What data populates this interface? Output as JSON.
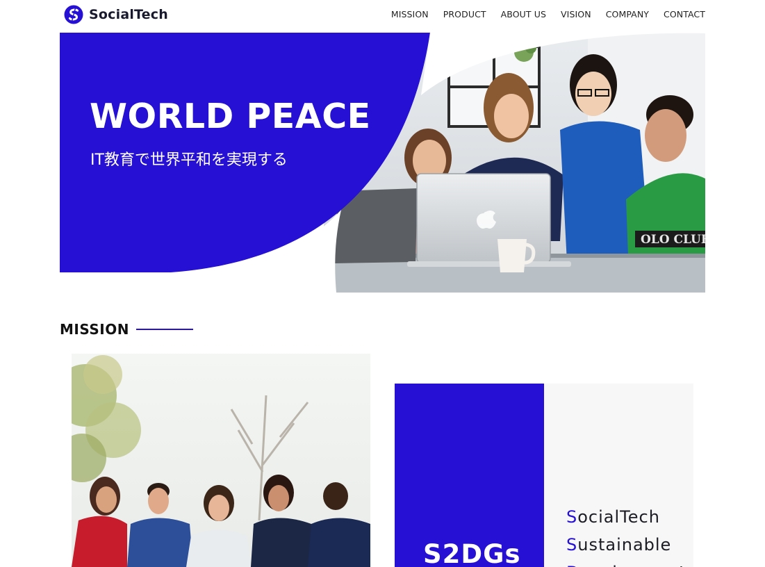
{
  "header": {
    "brand": "SocialTech",
    "nav": [
      "MISSION",
      "PRODUCT",
      "ABOUT US",
      "VISION",
      "COMPANY",
      "CONTACT"
    ]
  },
  "hero": {
    "title": "WORLD PEACE",
    "subtitle": "IT教育で世界平和を実現する"
  },
  "mission": {
    "heading": "MISSION",
    "card": {
      "title": "S2DGs",
      "lines": [
        {
          "initial": "S",
          "rest": "ocialTech"
        },
        {
          "initial": "S",
          "rest": "ustainable"
        },
        {
          "initial": "D",
          "rest": "evelopment"
        }
      ]
    }
  },
  "colors": {
    "accent": "#2510d4",
    "text": "#111111",
    "card_grey": "#f7f7f8"
  }
}
